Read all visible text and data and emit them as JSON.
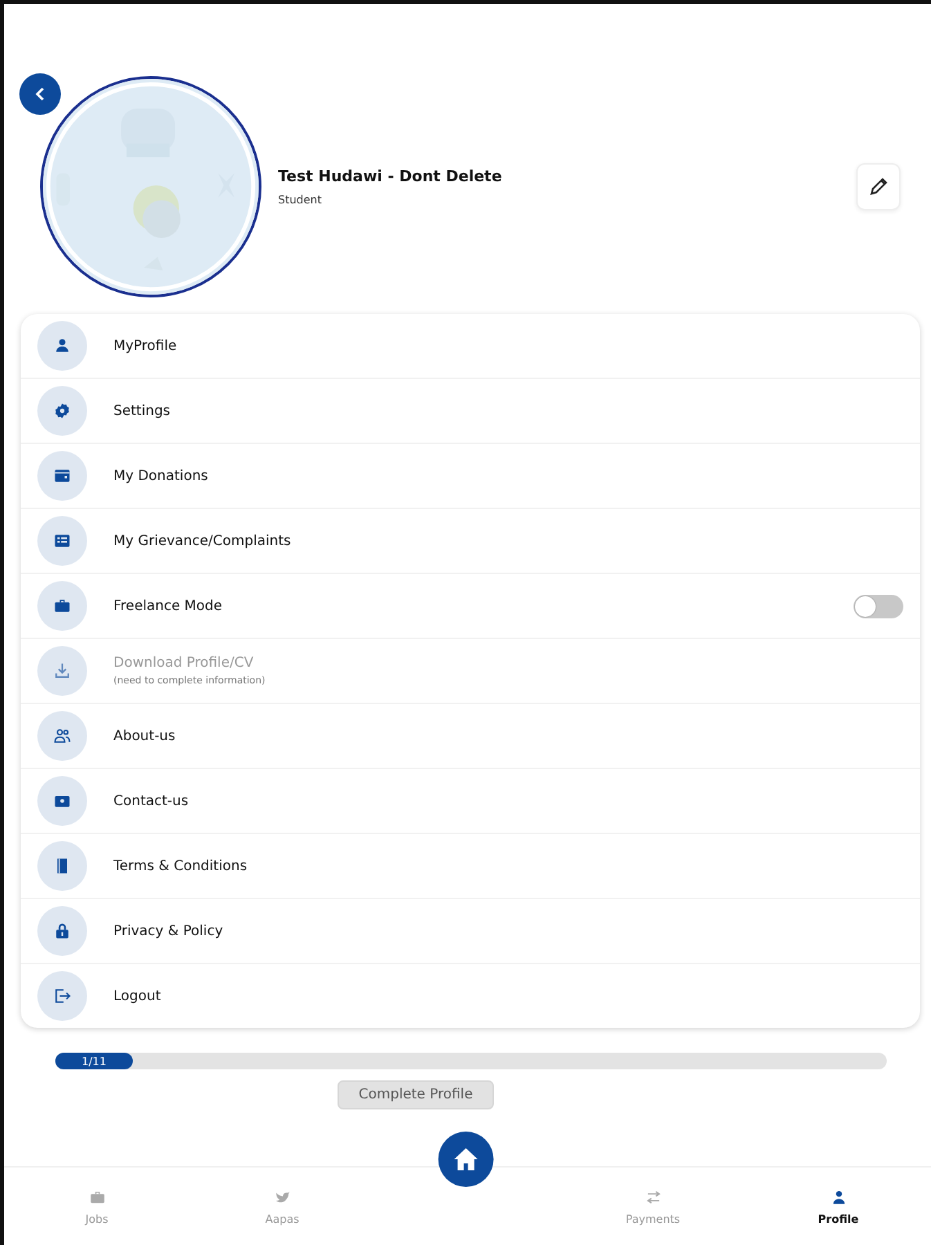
{
  "header": {
    "name": "Test Hudawi - Dont Delete",
    "role": "Student"
  },
  "menu": [
    {
      "label": "MyProfile",
      "kind": "link",
      "disabled": false
    },
    {
      "label": "Settings",
      "kind": "link",
      "disabled": false
    },
    {
      "label": "My Donations",
      "kind": "link",
      "disabled": false
    },
    {
      "label": "My Grievance/Complaints",
      "kind": "link",
      "disabled": false
    },
    {
      "label": "Freelance Mode",
      "kind": "toggle",
      "on": false,
      "disabled": false
    },
    {
      "label": "Download Profile/CV",
      "note": "(need to complete information)",
      "kind": "link",
      "disabled": true
    },
    {
      "label": "About-us",
      "kind": "link",
      "disabled": false
    },
    {
      "label": "Contact-us",
      "kind": "link",
      "disabled": false
    },
    {
      "label": "Terms & Conditions",
      "kind": "link",
      "disabled": false
    },
    {
      "label": "Privacy & Policy",
      "kind": "link",
      "disabled": false
    },
    {
      "label": "Logout",
      "kind": "link",
      "disabled": false
    }
  ],
  "progress": {
    "reading": "1/11",
    "level": 0.09,
    "button": "Complete Profile"
  },
  "nav": [
    {
      "label": "Jobs",
      "selected": false
    },
    {
      "label": "Aapas",
      "selected": false
    },
    {
      "label": "Payments",
      "selected": false
    },
    {
      "label": "Profile",
      "selected": true
    }
  ]
}
